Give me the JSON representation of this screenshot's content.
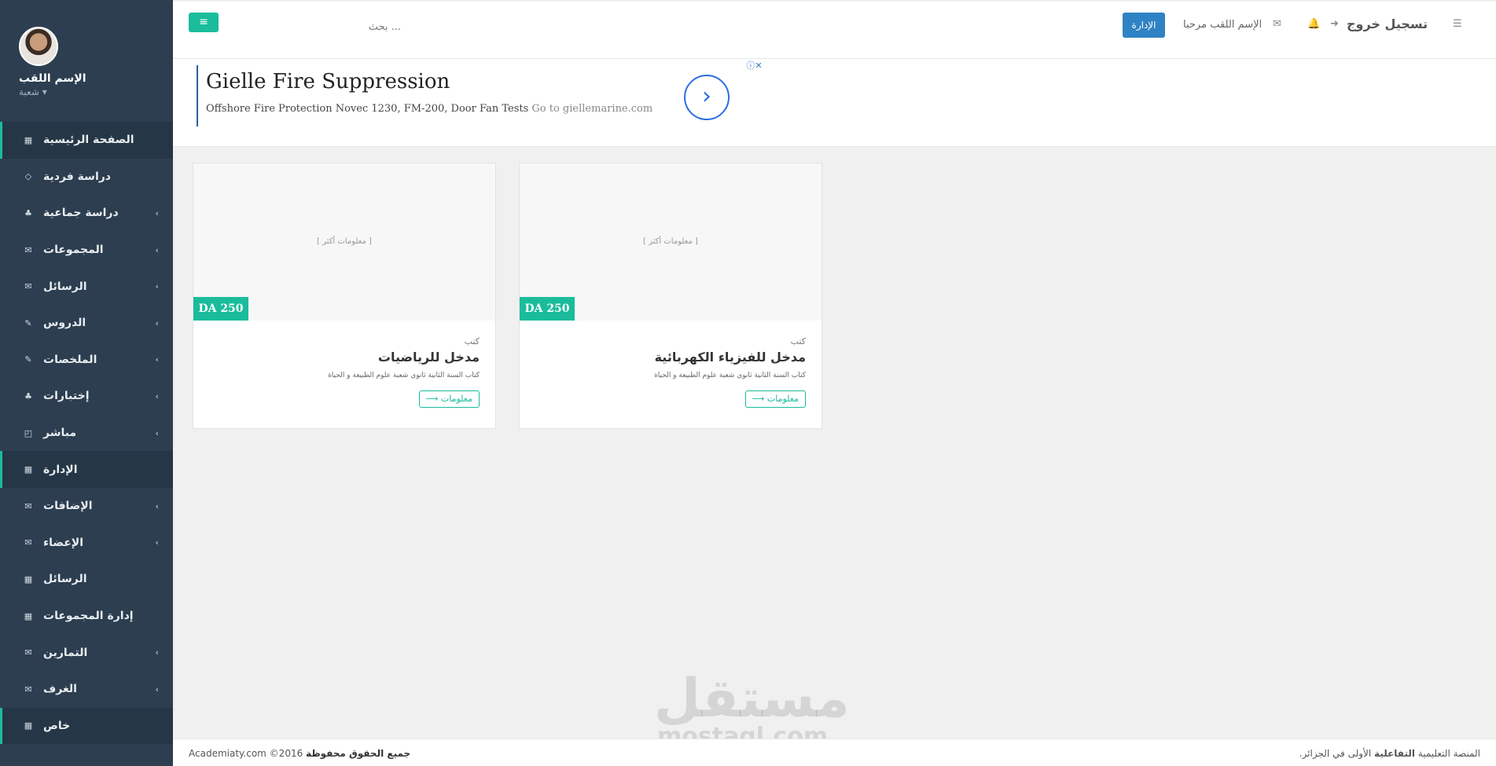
{
  "profile": {
    "name": "الإسم اللقب",
    "role": "شعبة"
  },
  "menu": [
    {
      "label": "الصفحة الرئيسية",
      "icon": "▦",
      "chevron": "",
      "active": true
    },
    {
      "label": "دراسة فردية",
      "icon": "◇",
      "chevron": "",
      "active": false
    },
    {
      "label": "دراسة جماعية",
      "icon": "♣",
      "chevron": "‹",
      "active": false
    },
    {
      "label": "المجموعات",
      "icon": "✉",
      "chevron": "‹",
      "active": false
    },
    {
      "label": "الرسائل",
      "icon": "✉",
      "chevron": "‹",
      "active": false
    },
    {
      "label": "الدروس",
      "icon": "✎",
      "chevron": "‹",
      "active": false
    },
    {
      "label": "الملخصات",
      "icon": "✎",
      "chevron": "‹",
      "active": false
    },
    {
      "label": "إختبارات",
      "icon": "♣",
      "chevron": "‹",
      "active": false
    },
    {
      "label": "مباشر",
      "icon": "◰",
      "chevron": "‹",
      "active": false
    },
    {
      "label": "الإدارة",
      "icon": "▦",
      "chevron": "",
      "active": true
    },
    {
      "label": "الإضافات",
      "icon": "✉",
      "chevron": "‹",
      "active": false
    },
    {
      "label": "الإعضاء",
      "icon": "✉",
      "chevron": "‹",
      "active": false
    },
    {
      "label": "الرسائل",
      "icon": "▦",
      "chevron": "",
      "active": false
    },
    {
      "label": "إدارة المجموعات",
      "icon": "▦",
      "chevron": "",
      "active": false
    },
    {
      "label": "التمارين",
      "icon": "✉",
      "chevron": "‹",
      "active": false
    },
    {
      "label": "الغرف",
      "icon": "✉",
      "chevron": "‹",
      "active": false
    },
    {
      "label": "خاص",
      "icon": "▦",
      "chevron": "",
      "active": true
    }
  ],
  "topbar": {
    "toggle_icon": "≡",
    "search_placeholder": "... بحث",
    "admin_label": "الإدارة",
    "greeting": "الإسم اللقب مرحبا",
    "mail_icon": "✉",
    "bell_icon": "🔔",
    "logout_icon": "➜",
    "logout_label": "تسجيل خروج",
    "list_icon": "☰"
  },
  "ad": {
    "title": "Gielle Fire Suppression",
    "text": "Offshore Fire Protection Novec 1230, FM-200, Door Fan Tests",
    "link": "Go to giellemarine.com",
    "arrow": "›",
    "choice": "ⓘ✕"
  },
  "cards": [
    {
      "more": "[ معلومات أكثر ]",
      "price": "DA 250",
      "category": "كتب",
      "title": "مدخل للرياضيات",
      "desc": "كتاب السنة الثانية ثانوي شعبة علوم الطبيعة و الحياة",
      "button": "معلومات ⟶"
    },
    {
      "more": "[ معلومات أكثر ]",
      "price": "DA 250",
      "category": "كتب",
      "title": "مدخل للفيزياء الكهربائية",
      "desc": "كتاب السنة الثانية ثانوي شعبة علوم الطبيعة و الحياة",
      "button": "معلومات ⟶"
    }
  ],
  "watermark": {
    "ar": "مستقل",
    "en": "mostaql.com"
  },
  "footer": {
    "left_site": "Academiaty.com ©2016",
    "left_rights": "جميع الحقوق محفوظة",
    "right_pre": "المنصة التعليمية",
    "right_bold": "التفاعلية",
    "right_post": "الأولى في الجزائر."
  }
}
